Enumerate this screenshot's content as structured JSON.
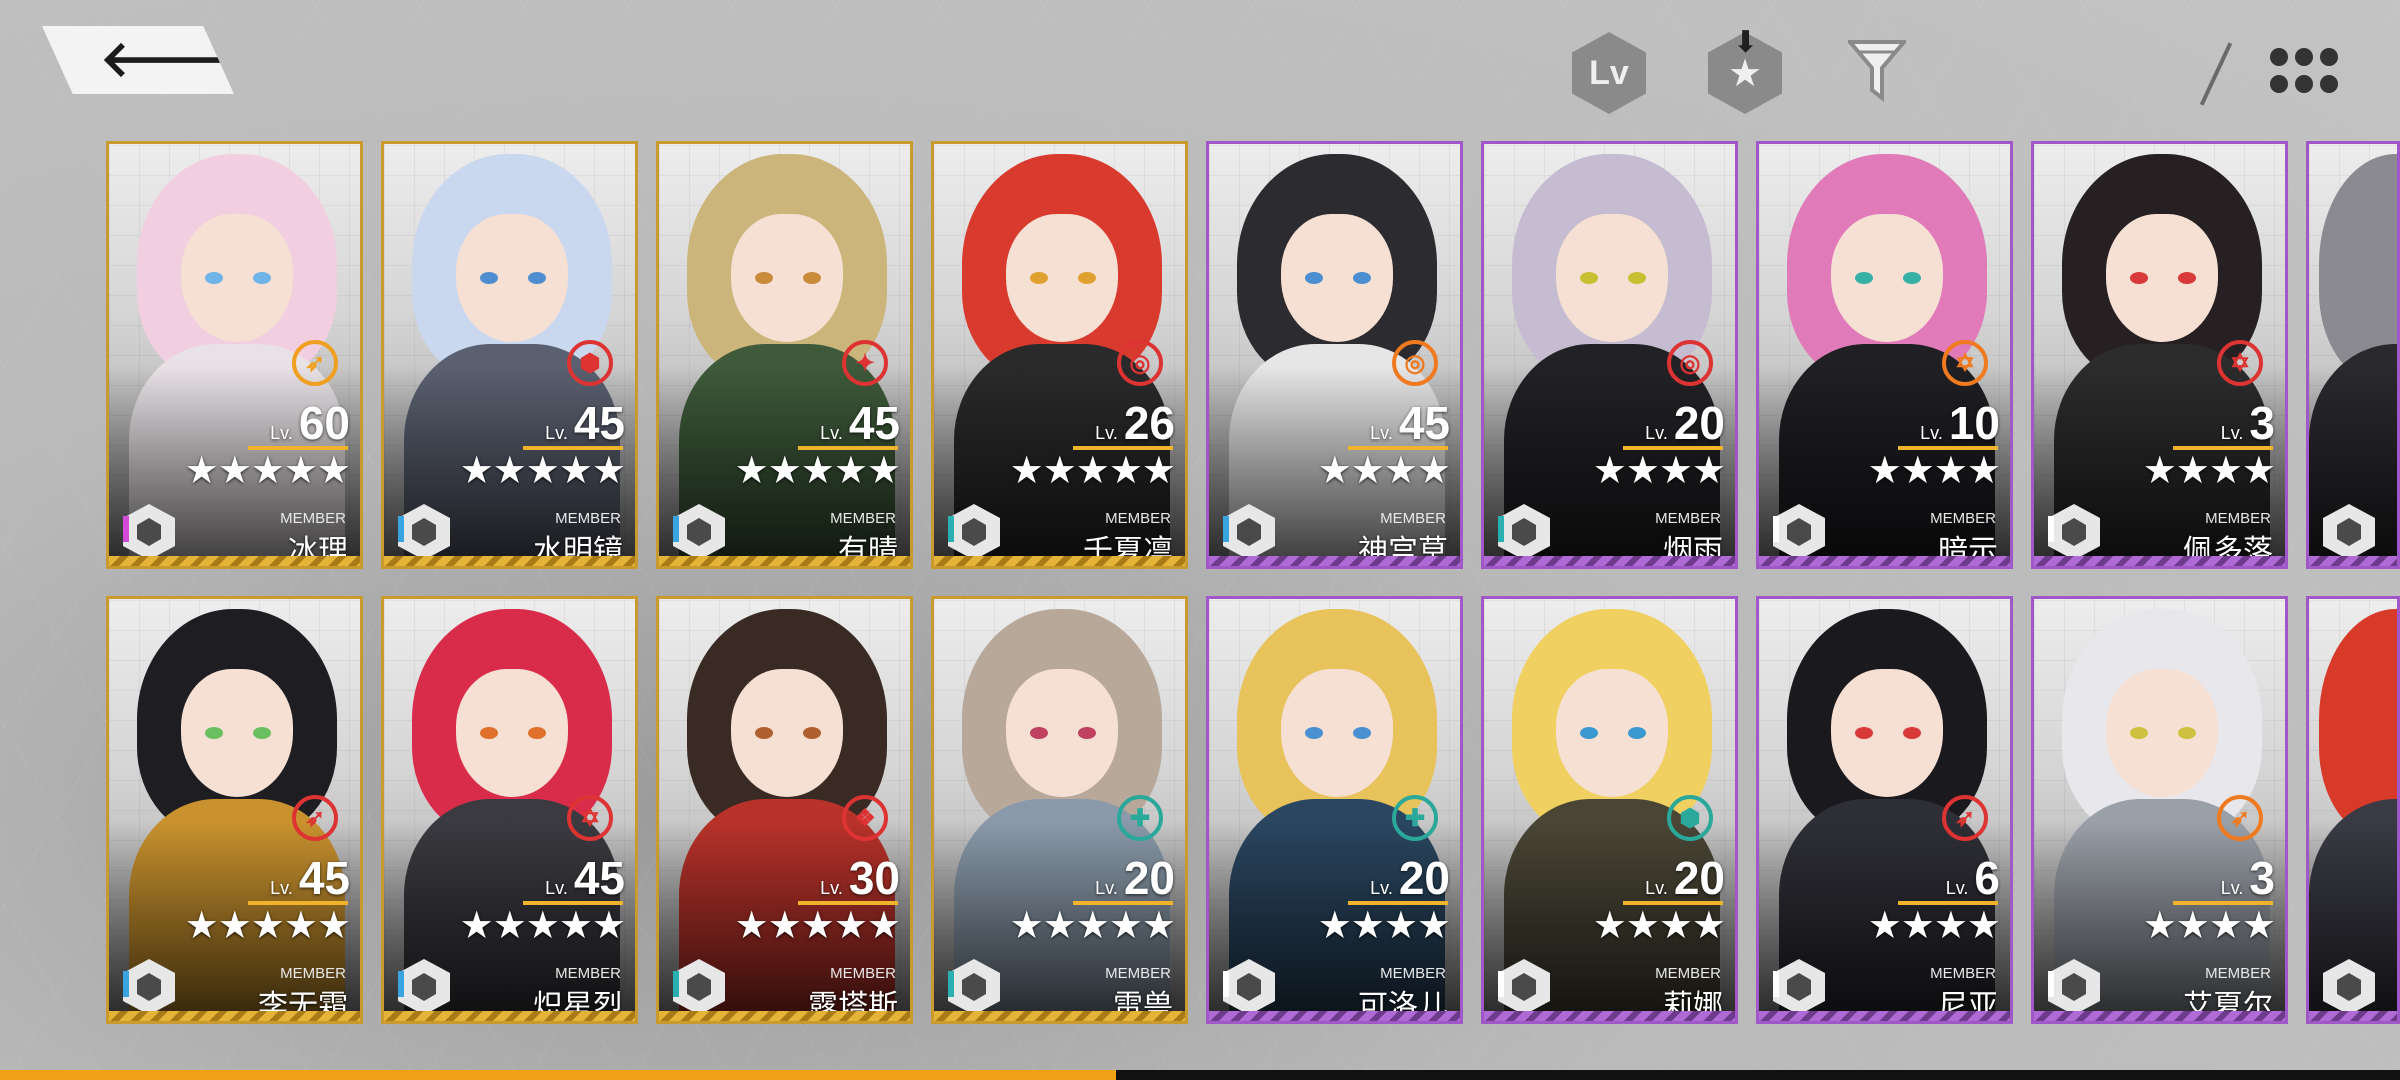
{
  "header": {
    "back_icon": "back-arrow-icon",
    "lv_sort_label": "Lv",
    "rarity_sort_icon": "star-sort-icon",
    "sort_direction_icon": "sort-down-arrow-icon",
    "filter_icon": "filter-funnel-icon",
    "view_toggle_icon": "grid-dots-icon"
  },
  "card_labels": {
    "level_prefix": "Lv.",
    "member_tag": "MEMBER"
  },
  "row1": [
    {
      "name": "冰理",
      "level": "60",
      "stars": "★★★★★",
      "rarity": 5,
      "frame": "gold",
      "hair": "#f2cfe0",
      "eye": "#6fb4e8",
      "outfit": "#e8e2e6",
      "cls_color": "#f0a020",
      "cls_glyph": "➶",
      "accent": "#d24bd8"
    },
    {
      "name": "水明镜",
      "level": "45",
      "stars": "★★★★★",
      "rarity": 5,
      "frame": "gold",
      "hair": "#c9d7ef",
      "eye": "#4e8ed0",
      "outfit": "#5a6070",
      "cls_color": "#d33",
      "cls_glyph": "⬢",
      "accent": "#3aa4e0"
    },
    {
      "name": "有晴",
      "level": "45",
      "stars": "★★★★★",
      "rarity": 5,
      "frame": "gold",
      "hair": "#cbb57a",
      "eye": "#c98a3a",
      "outfit": "#3e5a3a",
      "cls_color": "#d33",
      "cls_glyph": "✦",
      "accent": "#3aa4e0"
    },
    {
      "name": "千夏凛",
      "level": "26",
      "stars": "★★★★★",
      "rarity": 5,
      "frame": "gold",
      "hair": "#d93a2e",
      "eye": "#e0a030",
      "outfit": "#2a2a2a",
      "cls_color": "#d33",
      "cls_glyph": "◎",
      "accent": "#2ab0b0"
    },
    {
      "name": "神宫草",
      "level": "45",
      "stars": "★★★★",
      "rarity": 4,
      "frame": "purple",
      "hair": "#2b2b30",
      "eye": "#4b8fd0",
      "outfit": "#e6e6e6",
      "cls_color": "#f07a20",
      "cls_glyph": "◎",
      "accent": "#3aa4e0"
    },
    {
      "name": "烟雨",
      "level": "20",
      "stars": "★★★★",
      "rarity": 4,
      "frame": "purple",
      "hair": "#c5bcd2",
      "eye": "#c7c032",
      "outfit": "#222226",
      "cls_color": "#d33",
      "cls_glyph": "◎",
      "accent": "#2ab0b0"
    },
    {
      "name": "暗示",
      "level": "10",
      "stars": "★★★★",
      "rarity": 4,
      "frame": "purple",
      "hair": "#e07ab8",
      "eye": "#35b0a5",
      "outfit": "#1f1f24",
      "cls_color": "#f07a20",
      "cls_glyph": "✡",
      "accent": "#ffffff"
    },
    {
      "name": "佩多落",
      "level": "3",
      "stars": "★★★★",
      "rarity": 4,
      "frame": "purple",
      "hair": "#262022",
      "eye": "#d83a3a",
      "outfit": "#2c2c2c",
      "cls_color": "#d33",
      "cls_glyph": "✡",
      "accent": "#ffffff"
    }
  ],
  "row2": [
    {
      "name": "李无霜",
      "level": "45",
      "stars": "★★★★★",
      "rarity": 5,
      "frame": "gold",
      "hair": "#1e1e22",
      "eye": "#6ac060",
      "outfit": "#c9922e",
      "cls_color": "#d33",
      "cls_glyph": "➶",
      "accent": "#3aa4e0"
    },
    {
      "name": "炽星烈",
      "level": "45",
      "stars": "★★★★★",
      "rarity": 5,
      "frame": "gold",
      "hair": "#d92b4a",
      "eye": "#e0702a",
      "outfit": "#3a3a40",
      "cls_color": "#d33",
      "cls_glyph": "✡",
      "accent": "#3aa4e0"
    },
    {
      "name": "露塔斯",
      "level": "30",
      "stars": "★★★★★",
      "rarity": 5,
      "frame": "gold",
      "hair": "#3a2a24",
      "eye": "#b06030",
      "outfit": "#b8322a",
      "cls_color": "#d33",
      "cls_glyph": "❖",
      "accent": "#2ab0b0"
    },
    {
      "name": "雷兽",
      "level": "20",
      "stars": "★★★★★",
      "rarity": 5,
      "frame": "gold",
      "hair": "#b8a89a",
      "eye": "#c04060",
      "outfit": "#8a9aaa",
      "cls_color": "#2aa89a",
      "cls_glyph": "✚",
      "accent": "#2ab0b0"
    },
    {
      "name": "可洛儿",
      "level": "20",
      "stars": "★★★★",
      "rarity": 4,
      "frame": "purple",
      "hair": "#e8c25a",
      "eye": "#4a8fd0",
      "outfit": "#2a4660",
      "cls_color": "#2aa89a",
      "cls_glyph": "✚",
      "accent": "#ffffff"
    },
    {
      "name": "莉娜",
      "level": "20",
      "stars": "★★★★",
      "rarity": 4,
      "frame": "purple",
      "hair": "#f0d060",
      "eye": "#3a9ad0",
      "outfit": "#4a4636",
      "cls_color": "#2aa89a",
      "cls_glyph": "⬢",
      "accent": "#ffffff"
    },
    {
      "name": "尼亚",
      "level": "6",
      "stars": "★★★★",
      "rarity": 4,
      "frame": "purple",
      "hair": "#1a1a1e",
      "eye": "#d83a3a",
      "outfit": "#2e2e36",
      "cls_color": "#d33",
      "cls_glyph": "➶",
      "accent": "#ffffff"
    },
    {
      "name": "艾夏尔",
      "level": "3",
      "stars": "★★★★",
      "rarity": 4,
      "frame": "purple",
      "hair": "#e8e8ec",
      "eye": "#d0c040",
      "outfit": "#9aa0a8",
      "cls_color": "#f07a20",
      "cls_glyph": "➶",
      "accent": "#ffffff"
    }
  ],
  "partial_cards": [
    {
      "hair": "#8a8a90",
      "outfit": "#2a2a2e"
    },
    {
      "hair": "#d83a2a",
      "outfit": "#3a3a44"
    }
  ],
  "scroll_progress": 0.465
}
